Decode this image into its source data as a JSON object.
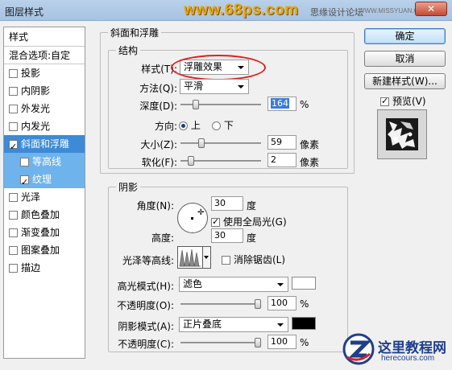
{
  "window": {
    "title": "图层样式",
    "watermark_site": "www.68ps.com",
    "watermark_forum": "思缘设计论坛",
    "watermark_url": "WWW.MISSYUAN.COM"
  },
  "style_list": {
    "header": "样式",
    "blend_options": "混合选项:自定",
    "items": [
      {
        "label": "投影",
        "checked": false
      },
      {
        "label": "内阴影",
        "checked": false
      },
      {
        "label": "外发光",
        "checked": false
      },
      {
        "label": "内发光",
        "checked": false
      },
      {
        "label": "斜面和浮雕",
        "checked": true,
        "selected": true
      },
      {
        "label": "等高线",
        "checked": false,
        "sub": true
      },
      {
        "label": "纹理",
        "checked": true,
        "sub": true
      },
      {
        "label": "光泽",
        "checked": false
      },
      {
        "label": "颜色叠加",
        "checked": false
      },
      {
        "label": "渐变叠加",
        "checked": false
      },
      {
        "label": "图案叠加",
        "checked": false
      },
      {
        "label": "描边",
        "checked": false
      }
    ]
  },
  "bevel": {
    "group_title": "斜面和浮雕",
    "structure_title": "结构",
    "style_label": "样式(T):",
    "style_value": "浮雕效果",
    "technique_label": "方法(Q):",
    "technique_value": "平滑",
    "depth_label": "深度(D):",
    "depth_value": "164",
    "depth_unit": "%",
    "direction_label": "方向:",
    "direction_up": "上",
    "direction_down": "下",
    "direction_selected": "上",
    "size_label": "大小(Z):",
    "size_value": "59",
    "size_unit": "像素",
    "soften_label": "软化(F):",
    "soften_value": "2",
    "soften_unit": "像素"
  },
  "shading": {
    "group_title": "阴影",
    "angle_label": "角度(N):",
    "angle_value": "30",
    "angle_unit": "度",
    "global_light_label": "使用全局光(G)",
    "global_light_checked": true,
    "altitude_label": "高度:",
    "altitude_value": "30",
    "altitude_unit": "度",
    "gloss_contour_label": "光泽等高线:",
    "anti_alias_label": "消除锯齿(L)",
    "anti_alias_checked": false,
    "highlight_mode_label": "高光模式(H):",
    "highlight_mode_value": "滤色",
    "highlight_color": "#ffffff",
    "highlight_opacity_label": "不透明度(O):",
    "highlight_opacity_value": "100",
    "highlight_opacity_unit": "%",
    "shadow_mode_label": "阴影模式(A):",
    "shadow_mode_value": "正片叠底",
    "shadow_color": "#000000",
    "shadow_opacity_label": "不透明度(C):",
    "shadow_opacity_value": "100",
    "shadow_opacity_unit": "%"
  },
  "sliders": {
    "depth": 0.16,
    "size": 0.24,
    "soften": 0.1,
    "highlight_opacity": 1.0,
    "shadow_opacity": 1.0
  },
  "buttons": {
    "ok": "确定",
    "cancel": "取消",
    "new_style": "新建样式(W)...",
    "preview_label": "预览(V)",
    "preview_checked": true
  },
  "corner_watermark": {
    "name": "这里教程网",
    "url": "herecours.com"
  }
}
